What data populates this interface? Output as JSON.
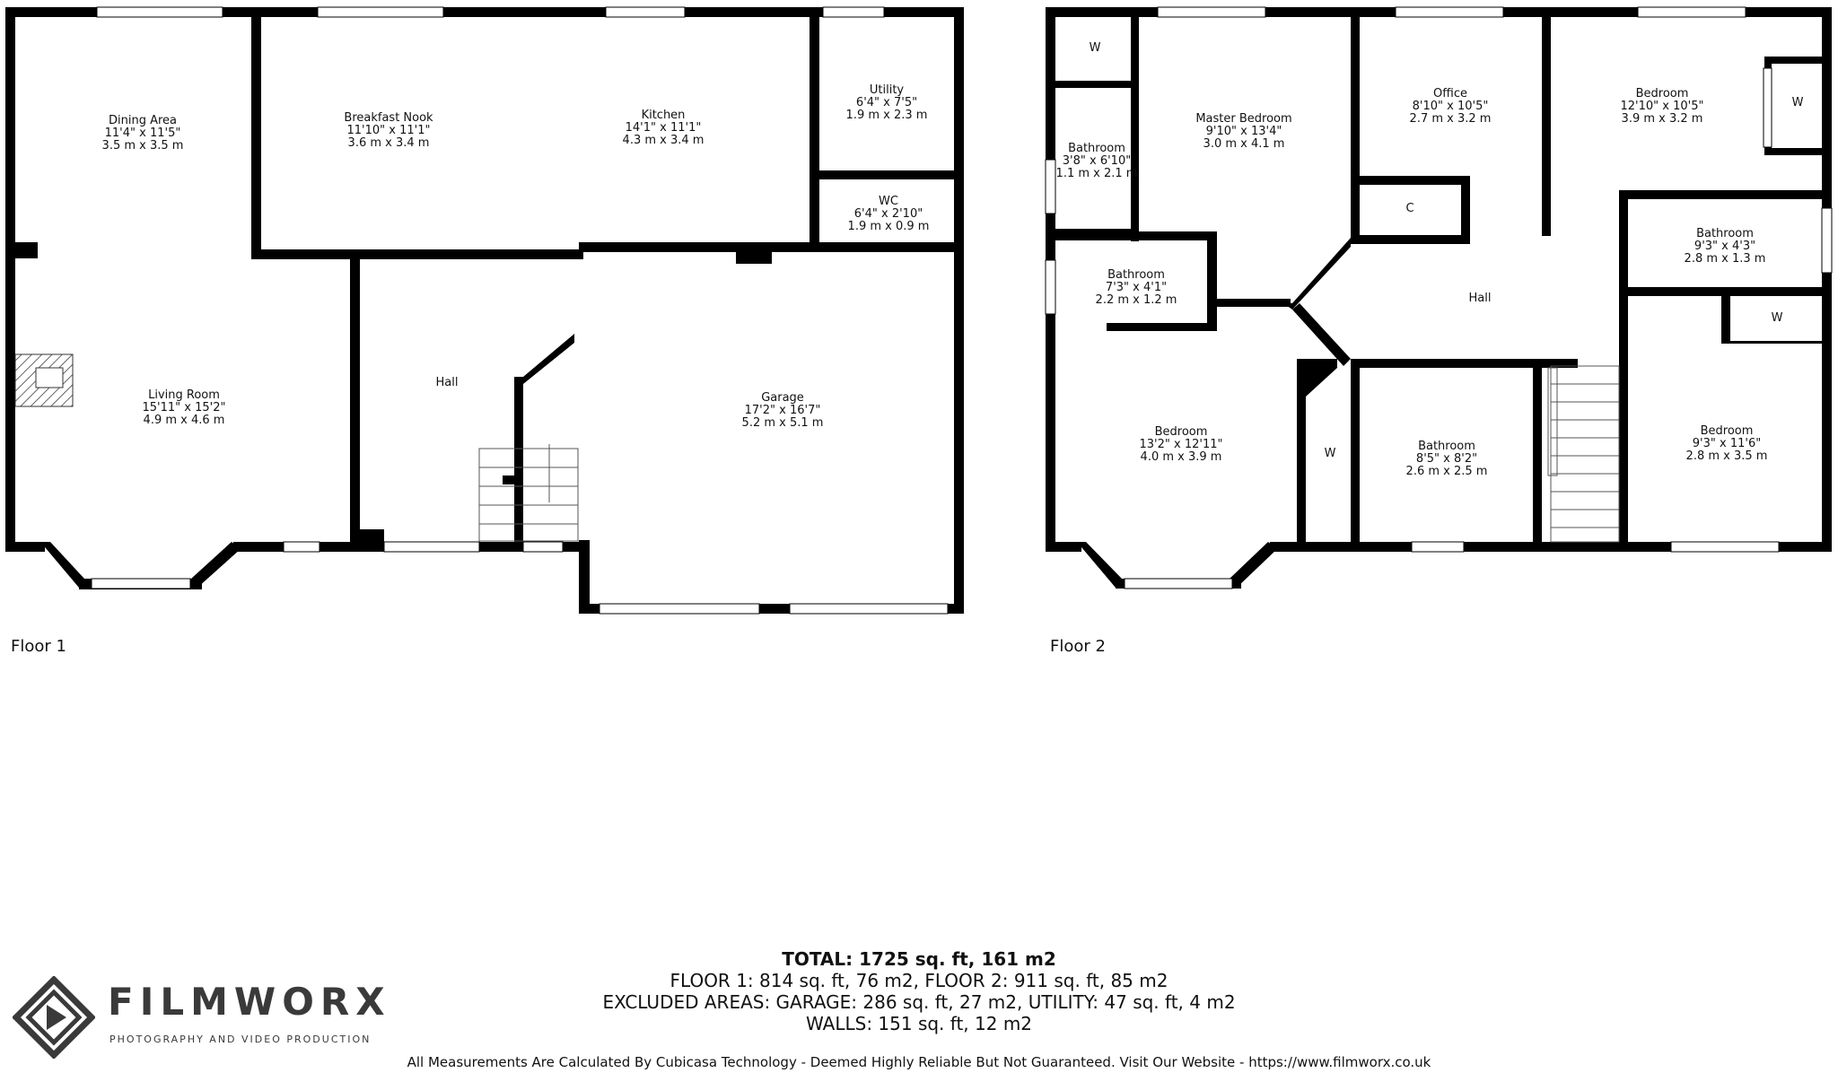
{
  "floor1": {
    "label": "Floor 1",
    "rooms": [
      {
        "id": "dining-area",
        "name": "Dining Area",
        "imperial": "11'4\" x 11'5\"",
        "metric": "3.5 m x 3.5 m"
      },
      {
        "id": "breakfast-nook",
        "name": "Breakfast Nook",
        "imperial": "11'10\" x 11'1\"",
        "metric": "3.6 m x 3.4 m"
      },
      {
        "id": "kitchen",
        "name": "Kitchen",
        "imperial": "14'1\" x 11'1\"",
        "metric": "4.3 m x 3.4 m"
      },
      {
        "id": "utility",
        "name": "Utility",
        "imperial": "6'4\" x 7'5\"",
        "metric": "1.9 m x 2.3 m"
      },
      {
        "id": "wc",
        "name": "WC",
        "imperial": "6'4\" x 2'10\"",
        "metric": "1.9 m x 0.9 m"
      },
      {
        "id": "living-room",
        "name": "Living Room",
        "imperial": "15'11\" x 15'2\"",
        "metric": "4.9 m x 4.6 m"
      },
      {
        "id": "hall-1",
        "name": "Hall",
        "imperial": "",
        "metric": ""
      },
      {
        "id": "garage",
        "name": "Garage",
        "imperial": "17'2\" x 16'7\"",
        "metric": "5.2 m x 5.1 m"
      }
    ]
  },
  "floor2": {
    "label": "Floor 2",
    "rooms": [
      {
        "id": "wardrobe-1",
        "name": "W",
        "imperial": "",
        "metric": ""
      },
      {
        "id": "bathroom-a",
        "name": "Bathroom",
        "imperial": "3'8\" x 6'10\"",
        "metric": "1.1 m x 2.1 m"
      },
      {
        "id": "master-bedroom",
        "name": "Master Bedroom",
        "imperial": "9'10\" x 13'4\"",
        "metric": "3.0 m x 4.1 m"
      },
      {
        "id": "office",
        "name": "Office",
        "imperial": "8'10\" x 10'5\"",
        "metric": "2.7 m x 3.2 m"
      },
      {
        "id": "bedroom-ne",
        "name": "Bedroom",
        "imperial": "12'10\" x 10'5\"",
        "metric": "3.9 m x 3.2 m"
      },
      {
        "id": "wardrobe-2",
        "name": "W",
        "imperial": "",
        "metric": ""
      },
      {
        "id": "closet",
        "name": "C",
        "imperial": "",
        "metric": ""
      },
      {
        "id": "bathroom-b",
        "name": "Bathroom",
        "imperial": "7'3\" x 4'1\"",
        "metric": "2.2 m x 1.2 m"
      },
      {
        "id": "bathroom-c",
        "name": "Bathroom",
        "imperial": "9'3\" x 4'3\"",
        "metric": "2.8 m x 1.3 m"
      },
      {
        "id": "hall-2",
        "name": "Hall",
        "imperial": "",
        "metric": ""
      },
      {
        "id": "wardrobe-3",
        "name": "W",
        "imperial": "",
        "metric": ""
      },
      {
        "id": "bedroom-sw",
        "name": "Bedroom",
        "imperial": "13'2\" x 12'11\"",
        "metric": "4.0 m x 3.9 m"
      },
      {
        "id": "wardrobe-4",
        "name": "W",
        "imperial": "",
        "metric": ""
      },
      {
        "id": "bathroom-d",
        "name": "Bathroom",
        "imperial": "8'5\" x 8'2\"",
        "metric": "2.6 m x 2.5 m"
      },
      {
        "id": "bedroom-se",
        "name": "Bedroom",
        "imperial": "9'3\" x 11'6\"",
        "metric": "2.8 m x 3.5 m"
      }
    ]
  },
  "summary": {
    "total": "TOTAL: 1725 sq. ft, 161 m2",
    "floors": "FLOOR 1: 814 sq. ft, 76 m2, FLOOR 2: 911 sq. ft, 85 m2",
    "excluded": "EXCLUDED AREAS: GARAGE: 286 sq. ft, 27 m2, UTILITY: 47 sq. ft, 4 m2",
    "walls": "WALLS: 151 sq. ft, 12 m2"
  },
  "disclaimer": "All Measurements Are Calculated By Cubicasa Technology - Deemed Highly Reliable But Not Guaranteed. Visit Our Website - https://www.filmworx.co.uk",
  "logo": {
    "brand": "FILMWORX",
    "tagline": "PHOTOGRAPHY AND VIDEO PRODUCTION",
    "color": "#3a3a3a"
  },
  "colors": {
    "wall": "#000000",
    "window": "#ffffff",
    "hatch": "#333333"
  }
}
